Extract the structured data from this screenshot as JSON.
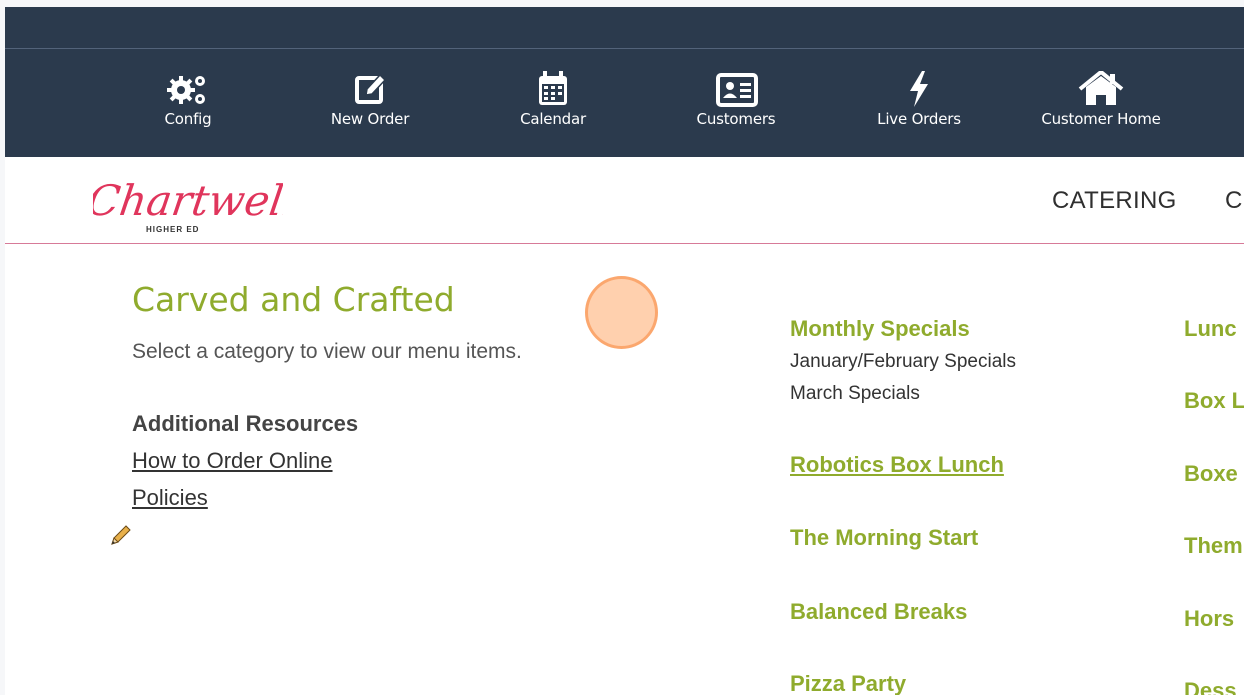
{
  "toolbar": {
    "items": [
      {
        "label": "Config",
        "icon": "gears-icon"
      },
      {
        "label": "New Order",
        "icon": "edit-icon"
      },
      {
        "label": "Calendar",
        "icon": "calendar-icon"
      },
      {
        "label": "Customers",
        "icon": "id-card-icon"
      },
      {
        "label": "Live Orders",
        "icon": "bolt-icon"
      },
      {
        "label": "Customer Home",
        "icon": "home-icon"
      }
    ]
  },
  "header": {
    "logo_text": "Chartwells",
    "logo_subtext": "HIGHER ED",
    "nav": [
      "CATERING",
      "C"
    ]
  },
  "main": {
    "title": "Carved and Crafted",
    "subtitle": "Select a category to view our menu items.",
    "resources_heading": "Additional Resources",
    "links": [
      "How to Order Online",
      "Policies"
    ]
  },
  "menu": {
    "col1": {
      "monthly": "Monthly Specials",
      "monthly_items": [
        "January/February Specials",
        "March Specials"
      ],
      "robotics": "Robotics Box Lunch",
      "morning": "The Morning Start",
      "breaks": "Balanced Breaks",
      "pizza": "Pizza Party"
    },
    "col2": [
      "Lunc",
      "Box L",
      "Boxe",
      "Them",
      "Hors",
      "Dess"
    ]
  },
  "colors": {
    "navy": "#2b3a4d",
    "accent_green": "#8fab2d",
    "logo_pink": "#e0355c"
  }
}
